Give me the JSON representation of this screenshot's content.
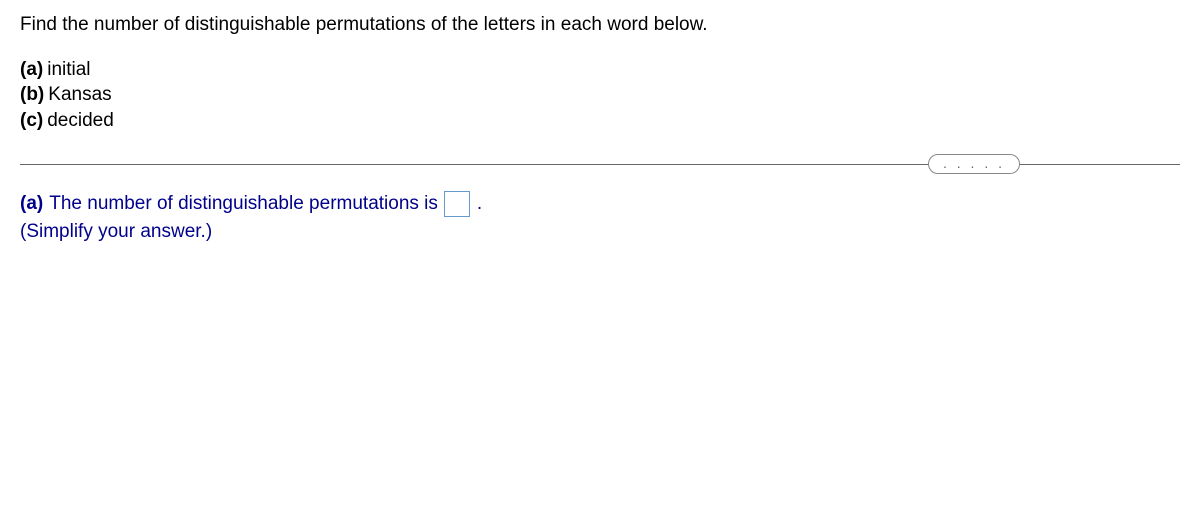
{
  "question": {
    "intro": "Find the number of distinguishable permutations of the letters in each word below.",
    "parts": [
      {
        "label": "(a)",
        "word": "initial"
      },
      {
        "label": "(b)",
        "word": "Kansas"
      },
      {
        "label": "(c)",
        "word": "decided"
      }
    ]
  },
  "divider": {
    "dots": ". . . . ."
  },
  "answer": {
    "part_label": "(a)",
    "text_before": "The number of distinguishable permutations is",
    "input_value": "",
    "period": ".",
    "simplify": "(Simplify your answer.)"
  }
}
